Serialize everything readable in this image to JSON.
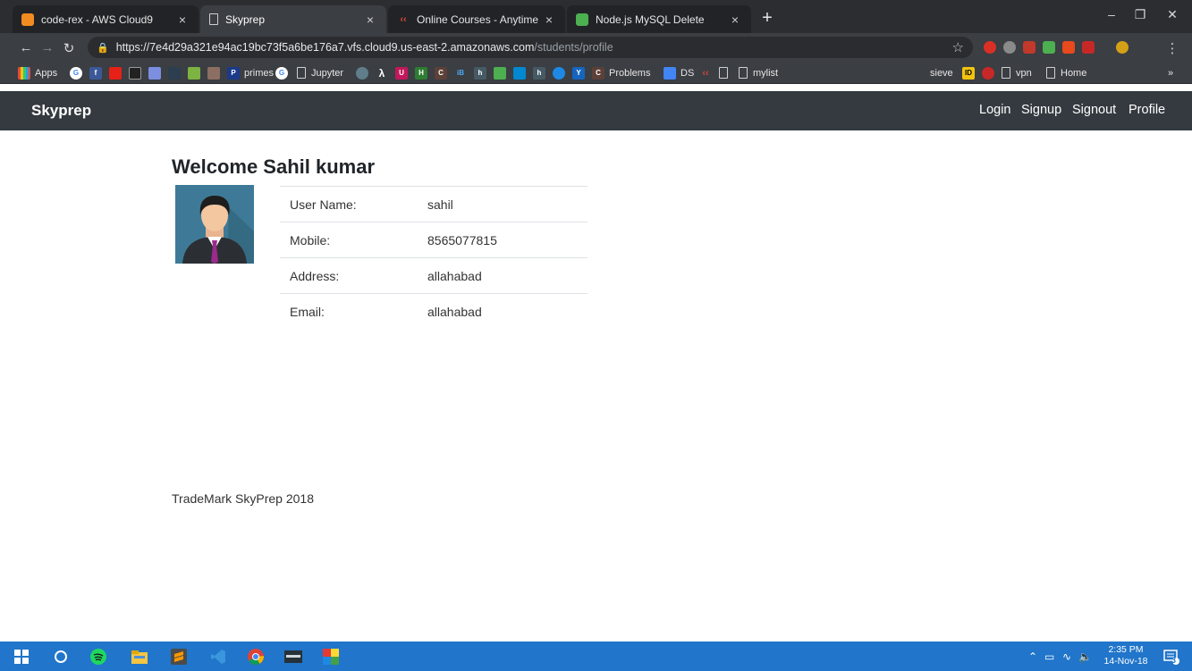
{
  "browser": {
    "tabs": [
      {
        "title": "code-rex - AWS Cloud9",
        "icon": "cloud9-icon",
        "color": "#f28b20"
      },
      {
        "title": "Skyprep",
        "icon": "page-icon",
        "color": "#cfcfcf"
      },
      {
        "title": "Online Courses - Anytime, Anywh",
        "icon": "courses-icon",
        "color": "#d1473c"
      },
      {
        "title": "Node.js MySQL Delete",
        "icon": "w3-icon",
        "color": "#4caf50"
      }
    ],
    "url_main": "https://7e4d29a321e94ac19bc73f5a6be176a7.vfs.cloud9.us-east-2.amazonaws.com",
    "url_path": "/students/profile",
    "bookmarks": [
      "Apps",
      "primes",
      "Jupyter",
      "Problems",
      "DS",
      "mylist",
      "sieve",
      "vpn",
      "Home"
    ]
  },
  "navbar": {
    "brand": "Skyprep",
    "links": [
      "Login",
      "Signup",
      "Signout",
      "Profile"
    ]
  },
  "profile": {
    "welcome": "Welcome Sahil kumar",
    "rows": [
      {
        "label": "User Name:",
        "value": "sahil"
      },
      {
        "label": "Mobile:",
        "value": "8565077815"
      },
      {
        "label": "Address:",
        "value": "allahabad"
      },
      {
        "label": "Email:",
        "value": "allahabad"
      }
    ]
  },
  "footer": {
    "text": "TradeMark SkyPrep 2018"
  },
  "taskbar": {
    "time": "2:35 PM",
    "date": "14-Nov-18",
    "notifications": "3"
  }
}
